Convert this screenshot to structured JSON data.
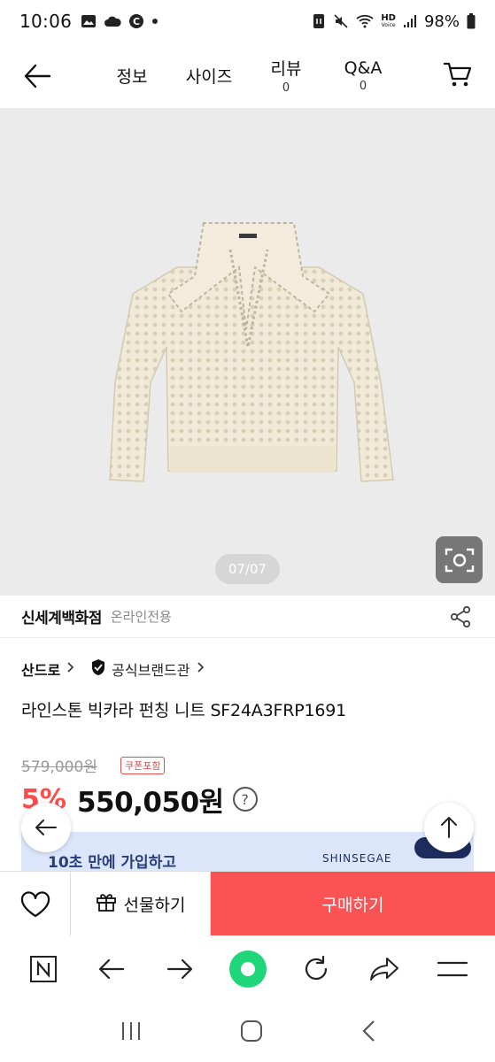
{
  "status": {
    "time": "10:06",
    "battery": "98%",
    "net_top": "HD",
    "net_bottom": "Voice"
  },
  "nav": {
    "tabs": [
      {
        "label": "정보"
      },
      {
        "label": "사이즈"
      },
      {
        "label": "리뷰",
        "count": "0"
      },
      {
        "label": "Q&A",
        "count": "0"
      }
    ]
  },
  "gallery": {
    "indicator": "07/07"
  },
  "store": {
    "name": "신세계백화점",
    "sub": "온라인전용"
  },
  "brand": {
    "name": "산드로",
    "official": "공식브랜드관"
  },
  "product": {
    "title": "라인스톤 빅카라 펀칭 니트 SF24A3FRP1691",
    "original_price": "579,000원",
    "coupon_badge": "쿠폰포함",
    "discount": "5%",
    "price": "550,050원",
    "help": "?"
  },
  "banner": {
    "text": "10초 만에 가입하고",
    "brand": "SHINSEGAE"
  },
  "actions": {
    "gift_label": "선물하기",
    "buy_label": "구매하기"
  },
  "colors": {
    "buy": "#fb5353",
    "discount": "#ff4a4a",
    "browser_accent": "#1fd67a"
  }
}
